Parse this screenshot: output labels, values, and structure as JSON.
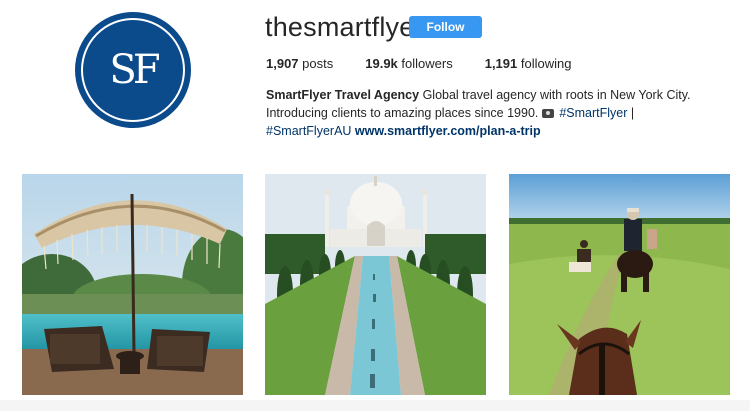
{
  "profile": {
    "avatar_monogram": "SF",
    "username": "thesmartflyer",
    "follow_label": "Follow",
    "stats": {
      "posts_value": "1,907",
      "posts_label": "posts",
      "followers_value": "19.9k",
      "followers_label": "followers",
      "following_value": "1,191",
      "following_label": "following"
    },
    "bio": {
      "name": "SmartFlyer Travel Agency",
      "text_1": " Global travel agency with roots in New York City. Introducing clients to amazing places since 1990. ",
      "hashtag_1": "#SmartFlyer",
      "separator": " | ",
      "hashtag_2": "#SmartFlyerAU",
      "link": "www.smartflyer.com/plan-a-trip"
    }
  },
  "posts": [
    {
      "subject": "resort-umbrella-pool"
    },
    {
      "subject": "taj-mahal"
    },
    {
      "subject": "horseback-safari"
    }
  ],
  "colors": {
    "brand_blue": "#0b4a8b",
    "follow_button": "#3897f0",
    "link": "#003569"
  }
}
